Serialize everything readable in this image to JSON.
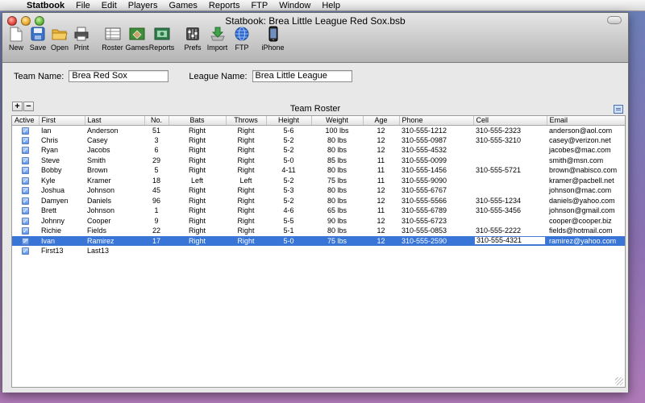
{
  "menubar": {
    "app": "Statbook",
    "items": [
      "File",
      "Edit",
      "Players",
      "Games",
      "Reports",
      "FTP",
      "Window",
      "Help"
    ]
  },
  "window": {
    "title": "Statbook: Brea Little League Red Sox.bsb"
  },
  "toolbar": {
    "buttons": [
      "New",
      "Save",
      "Open",
      "Print",
      "Roster",
      "Games",
      "Reports",
      "Prefs",
      "Import",
      "FTP",
      "iPhone"
    ]
  },
  "form": {
    "team_label": "Team Name:",
    "team_value": "Brea Red Sox",
    "league_label": "League Name:",
    "league_value": "Brea Little League"
  },
  "roster": {
    "title": "Team Roster",
    "add_label": "+",
    "remove_label": "−",
    "columns": [
      "Active",
      "First",
      "Last",
      "No.",
      "Bats",
      "Throws",
      "Height",
      "Weight",
      "Age",
      "Phone",
      "Cell",
      "Email"
    ],
    "rows": [
      {
        "active": true,
        "first": "Ian",
        "last": "Anderson",
        "no": "51",
        "bats": "Right",
        "throws": "Right",
        "height": "5-6",
        "weight": "100 lbs",
        "age": "12",
        "phone": "310-555-1212",
        "cell": "310-555-2323",
        "email": "anderson@aol.com"
      },
      {
        "active": true,
        "first": "Chris",
        "last": "Casey",
        "no": "3",
        "bats": "Right",
        "throws": "Right",
        "height": "5-2",
        "weight": "80 lbs",
        "age": "12",
        "phone": "310-555-0987",
        "cell": "310-555-3210",
        "email": "casey@verizon.net"
      },
      {
        "active": true,
        "first": "Ryan",
        "last": "Jacobs",
        "no": "6",
        "bats": "Right",
        "throws": "Right",
        "height": "5-2",
        "weight": "80 lbs",
        "age": "12",
        "phone": "310-555-4532",
        "cell": "",
        "email": "jacobes@mac.com"
      },
      {
        "active": true,
        "first": "Steve",
        "last": "Smith",
        "no": "29",
        "bats": "Right",
        "throws": "Right",
        "height": "5-0",
        "weight": "85 lbs",
        "age": "11",
        "phone": "310-555-0099",
        "cell": "",
        "email": "smith@msn.com"
      },
      {
        "active": true,
        "first": "Bobby",
        "last": "Brown",
        "no": "5",
        "bats": "Right",
        "throws": "Right",
        "height": "4-11",
        "weight": "80 lbs",
        "age": "11",
        "phone": "310-555-1456",
        "cell": "310-555-5721",
        "email": "brown@nabisco.com"
      },
      {
        "active": true,
        "first": "Kyle",
        "last": "Kramer",
        "no": "18",
        "bats": "Left",
        "throws": "Left",
        "height": "5-2",
        "weight": "75 lbs",
        "age": "11",
        "phone": "310-555-9090",
        "cell": "",
        "email": "kramer@pacbell.net"
      },
      {
        "active": true,
        "first": "Joshua",
        "last": "Johnson",
        "no": "45",
        "bats": "Right",
        "throws": "Right",
        "height": "5-3",
        "weight": "80 lbs",
        "age": "12",
        "phone": "310-555-6767",
        "cell": "",
        "email": "johnson@mac.com"
      },
      {
        "active": true,
        "first": "Damyen",
        "last": "Daniels",
        "no": "96",
        "bats": "Right",
        "throws": "Right",
        "height": "5-2",
        "weight": "80 lbs",
        "age": "12",
        "phone": "310-555-5566",
        "cell": "310-555-1234",
        "email": "daniels@yahoo.com"
      },
      {
        "active": true,
        "first": "Brett",
        "last": "Johnson",
        "no": "1",
        "bats": "Right",
        "throws": "Right",
        "height": "4-6",
        "weight": "65 lbs",
        "age": "11",
        "phone": "310-555-6789",
        "cell": "310-555-3456",
        "email": "johnson@gmail.com"
      },
      {
        "active": true,
        "first": "Johnny",
        "last": "Cooper",
        "no": "9",
        "bats": "Right",
        "throws": "Right",
        "height": "5-5",
        "weight": "90 lbs",
        "age": "12",
        "phone": "310-555-6723",
        "cell": "",
        "email": "cooper@cooper.biz"
      },
      {
        "active": true,
        "first": "Richie",
        "last": "Fields",
        "no": "22",
        "bats": "Right",
        "throws": "Right",
        "height": "5-1",
        "weight": "80 lbs",
        "age": "12",
        "phone": "310-555-0853",
        "cell": "310-555-2222",
        "email": "fields@hotmail.com"
      },
      {
        "active": true,
        "first": "Ivan",
        "last": "Ramirez",
        "no": "17",
        "bats": "Right",
        "throws": "Right",
        "height": "5-0",
        "weight": "75 lbs",
        "age": "12",
        "phone": "310-555-2590",
        "cell": "310-555-4321",
        "email": "ramirez@yahoo.com",
        "selected": true
      },
      {
        "active": true,
        "first": "First13",
        "last": "Last13",
        "no": "",
        "bats": "",
        "throws": "",
        "height": "",
        "weight": "",
        "age": "",
        "phone": "",
        "cell": "",
        "email": ""
      }
    ]
  },
  "colors": {
    "selection": "#3875d7",
    "window_bg": "#e8e8e8"
  }
}
